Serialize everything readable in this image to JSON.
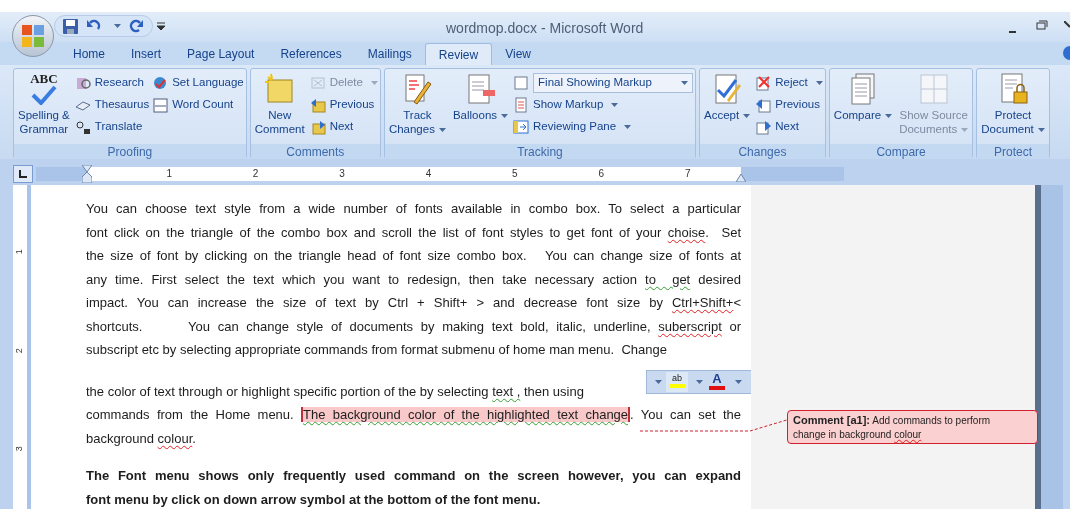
{
  "window": {
    "title": "wordmop.docx - Microsoft Word"
  },
  "tabs": [
    {
      "label": "Home",
      "selected": false
    },
    {
      "label": "Insert",
      "selected": false
    },
    {
      "label": "Page Layout",
      "selected": false
    },
    {
      "label": "References",
      "selected": false
    },
    {
      "label": "Mailings",
      "selected": false
    },
    {
      "label": "Review",
      "selected": true
    },
    {
      "label": "View",
      "selected": false
    }
  ],
  "ribbon": [
    {
      "label": "Proofing",
      "columns": [
        [
          {
            "kind": "large",
            "label": "Spelling &\nGrammar",
            "glyph": "ABC",
            "dropdown": false,
            "disabled": false
          }
        ],
        [
          {
            "kind": "small",
            "label": "Research",
            "dropdown": false,
            "disabled": false
          },
          {
            "kind": "small",
            "label": "Thesaurus",
            "dropdown": false,
            "disabled": false
          },
          {
            "kind": "small",
            "label": "Translate",
            "dropdown": false,
            "disabled": false
          }
        ],
        [
          {
            "kind": "small",
            "label": "Set Language",
            "dropdown": false,
            "disabled": false
          },
          {
            "kind": "small",
            "label": "Word Count",
            "dropdown": false,
            "disabled": false
          }
        ]
      ]
    },
    {
      "label": "Comments",
      "columns": [
        [
          {
            "kind": "large",
            "label": "New\nComment",
            "dropdown": false,
            "disabled": false
          }
        ],
        [
          {
            "kind": "small",
            "label": "Delete",
            "dropdown": true,
            "disabled": true
          },
          {
            "kind": "small",
            "label": "Previous",
            "dropdown": false,
            "disabled": false
          },
          {
            "kind": "small",
            "label": "Next",
            "dropdown": false,
            "disabled": false
          }
        ]
      ]
    },
    {
      "label": "Tracking",
      "columns": [
        [
          {
            "kind": "large",
            "label": "Track\nChanges",
            "dropdown": true,
            "disabled": false
          }
        ],
        [
          {
            "kind": "large",
            "label": "Balloons",
            "dropdown": true,
            "disabled": false
          }
        ],
        [
          {
            "kind": "combo",
            "label": "Final Showing Markup",
            "dropdown": true,
            "disabled": false
          },
          {
            "kind": "small",
            "label": "Show Markup",
            "dropdown": true,
            "disabled": false
          },
          {
            "kind": "small",
            "label": "Reviewing Pane",
            "dropdown": true,
            "disabled": false
          }
        ]
      ]
    },
    {
      "label": "Changes",
      "columns": [
        [
          {
            "kind": "large",
            "label": "Accept",
            "dropdown": true,
            "disabled": false
          }
        ],
        [
          {
            "kind": "small",
            "label": "Reject",
            "dropdown": true,
            "disabled": false
          },
          {
            "kind": "small",
            "label": "Previous",
            "dropdown": false,
            "disabled": false
          },
          {
            "kind": "small",
            "label": "Next",
            "dropdown": false,
            "disabled": false
          }
        ]
      ]
    },
    {
      "label": "Compare",
      "columns": [
        [
          {
            "kind": "large",
            "label": "Compare",
            "dropdown": true,
            "disabled": false
          }
        ],
        [
          {
            "kind": "large",
            "label": "Show Source\nDocuments",
            "dropdown": true,
            "disabled": true
          }
        ]
      ]
    },
    {
      "label": "Protect",
      "columns": [
        [
          {
            "kind": "large",
            "label": "Protect\nDocument",
            "dropdown": true,
            "disabled": false
          }
        ]
      ]
    }
  ],
  "ruler": {
    "numbers": [
      "1",
      "2",
      "3",
      "4",
      "5",
      "6",
      "7"
    ],
    "vertical_numbers": [
      "1",
      "2",
      "3"
    ]
  },
  "document": {
    "paragraphs": [
      {
        "bold": false,
        "lines": [
          [
            {
              "text": "You can choose text style from a wide number of fonts available in combo box. To select a particular",
              "kind": "plain"
            }
          ],
          [
            {
              "text": "font click on the triangle of the combo box and scroll the list of font styles to get font of your ",
              "kind": "plain"
            },
            {
              "text": "choise",
              "kind": "spelling"
            },
            {
              "text": ".  Set",
              "kind": "plain"
            }
          ],
          [
            {
              "text": "the size of font by clicking on the triangle head of font size combo box.   You can change size of fonts at",
              "kind": "plain"
            }
          ],
          [
            {
              "text": "any time. First select the text which you want to redesign, then take necessary action ",
              "kind": "plain"
            },
            {
              "text": "to  get",
              "kind": "grammar"
            },
            {
              "text": " desired",
              "kind": "plain"
            }
          ],
          [
            {
              "text": "impact. You can increase the size of text by Ctrl + Shift+ > and decrease font size by ",
              "kind": "plain"
            },
            {
              "text": "Ctrl+Shift+",
              "kind": "spelling"
            },
            {
              "text": "<",
              "kind": "plain"
            }
          ],
          [
            {
              "text": "shortcuts.      You can change style of documents by making text bold, italic, underline, ",
              "kind": "plain"
            },
            {
              "text": "suberscript",
              "kind": "spelling"
            },
            {
              "text": " or",
              "kind": "plain"
            }
          ],
          [
            {
              "text": "subscript etc by selecting appropriate commands from format submenu of home man menu.  Change",
              "kind": "plain"
            }
          ]
        ]
      },
      {
        "bold": false,
        "lines": [
          [
            {
              "text": "the color of text through or highlight specific portion of the by selecting ",
              "kind": "plain"
            },
            {
              "text": "text ,",
              "kind": "grammar"
            },
            {
              "text": " then using",
              "kind": "plain"
            }
          ],
          [
            {
              "text": "commands from the Home menu. ",
              "kind": "plain"
            },
            {
              "text": "The background color of the highlighted text change",
              "kind": "comment"
            },
            {
              "text": ". You can set the",
              "kind": "plain"
            }
          ],
          [
            {
              "text": "background ",
              "kind": "plain"
            },
            {
              "text": "colour",
              "kind": "spelling"
            },
            {
              "text": ".",
              "kind": "plain"
            }
          ]
        ]
      },
      {
        "bold": true,
        "lines": [
          [
            {
              "text": "The Font menu shows only frequently used command on the screen however, you can expand",
              "kind": "plain"
            }
          ],
          [
            {
              "text": "font menu by click on down arrow symbol at the bottom of the font menu.",
              "kind": "plain"
            }
          ]
        ]
      }
    ]
  },
  "mini_toolbar": {
    "highlight_glyph": "ab",
    "font_color_glyph": "A"
  },
  "comment": {
    "heading": "Comment [a1]:",
    "text": "Add commands to perform",
    "text_2": "change in background ",
    "flagged": "colour"
  }
}
